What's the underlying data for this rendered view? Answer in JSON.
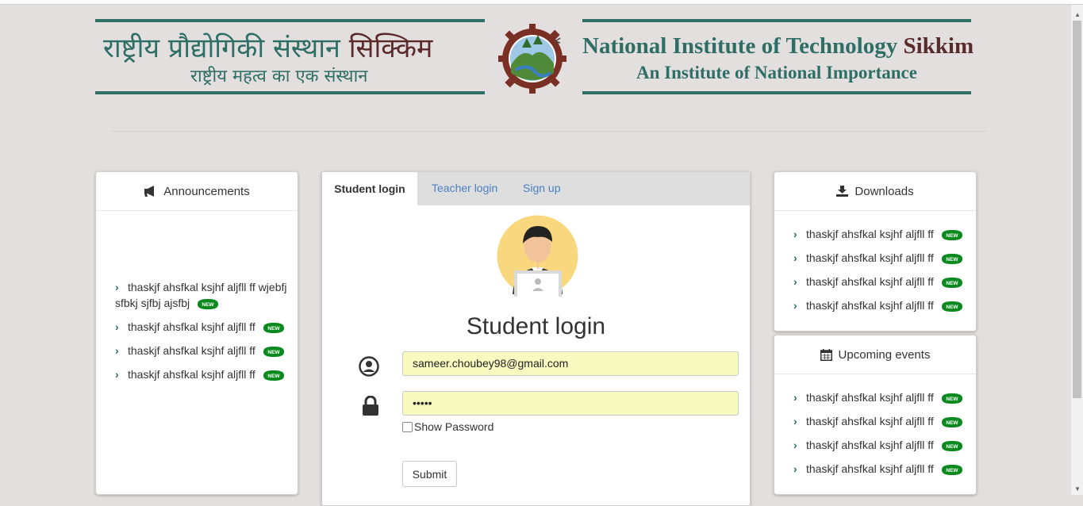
{
  "header": {
    "hindi_title_main": "राष्ट्रीय प्रौद्योगिकी संस्थान ",
    "hindi_title_accent": "सिक्किम",
    "hindi_subtitle": "राष्ट्रीय महत्व का एक संस्थान",
    "english_title_main": "National Institute of Technology ",
    "english_title_accent": "Sikkim",
    "english_subtitle": "An Institute of National Importance"
  },
  "announcements": {
    "title": "Announcements",
    "items": [
      {
        "text": "thaskjf ahsfkal ksjhf aljfll ff wjebfj sfbkj sjfbj ajsfbj",
        "badge": "NEW"
      },
      {
        "text": "thaskjf ahsfkal ksjhf aljfll ff",
        "badge": "NEW"
      },
      {
        "text": "thaskjf ahsfkal ksjhf aljfll ff",
        "badge": "NEW"
      },
      {
        "text": "thaskjf ahsfkal ksjhf aljfll ff",
        "badge": "NEW"
      }
    ]
  },
  "login": {
    "tabs": [
      "Student login",
      "Teacher login",
      "Sign up"
    ],
    "active_tab": "Student login",
    "title": "Student login",
    "email_value": "sameer.choubey98@gmail.com",
    "password_value": "•••••",
    "show_password_label": "Show Password",
    "submit_label": "Submit"
  },
  "downloads": {
    "title": "Downloads",
    "items": [
      {
        "text": "thaskjf ahsfkal ksjhf aljfll ff",
        "badge": "NEW"
      },
      {
        "text": "thaskjf ahsfkal ksjhf aljfll ff",
        "badge": "NEW"
      },
      {
        "text": "thaskjf ahsfkal ksjhf aljfll ff",
        "badge": "NEW"
      },
      {
        "text": "thaskjf ahsfkal ksjhf aljfll ff",
        "badge": "NEW"
      }
    ]
  },
  "events": {
    "title": "Upcoming events",
    "items": [
      {
        "text": "thaskjf ahsfkal ksjhf aljfll ff",
        "badge": "NEW"
      },
      {
        "text": "thaskjf ahsfkal ksjhf aljfll ff",
        "badge": "NEW"
      },
      {
        "text": "thaskjf ahsfkal ksjhf aljfll ff",
        "badge": "NEW"
      },
      {
        "text": "thaskjf ahsfkal ksjhf aljfll ff",
        "badge": "NEW"
      }
    ]
  },
  "colors": {
    "brand_green": "#2e6e65",
    "brand_maroon": "#5a2a2a",
    "link_blue": "#4a7fc1",
    "badge_green": "#0a8a1e",
    "input_fill": "#f8fbbf"
  }
}
